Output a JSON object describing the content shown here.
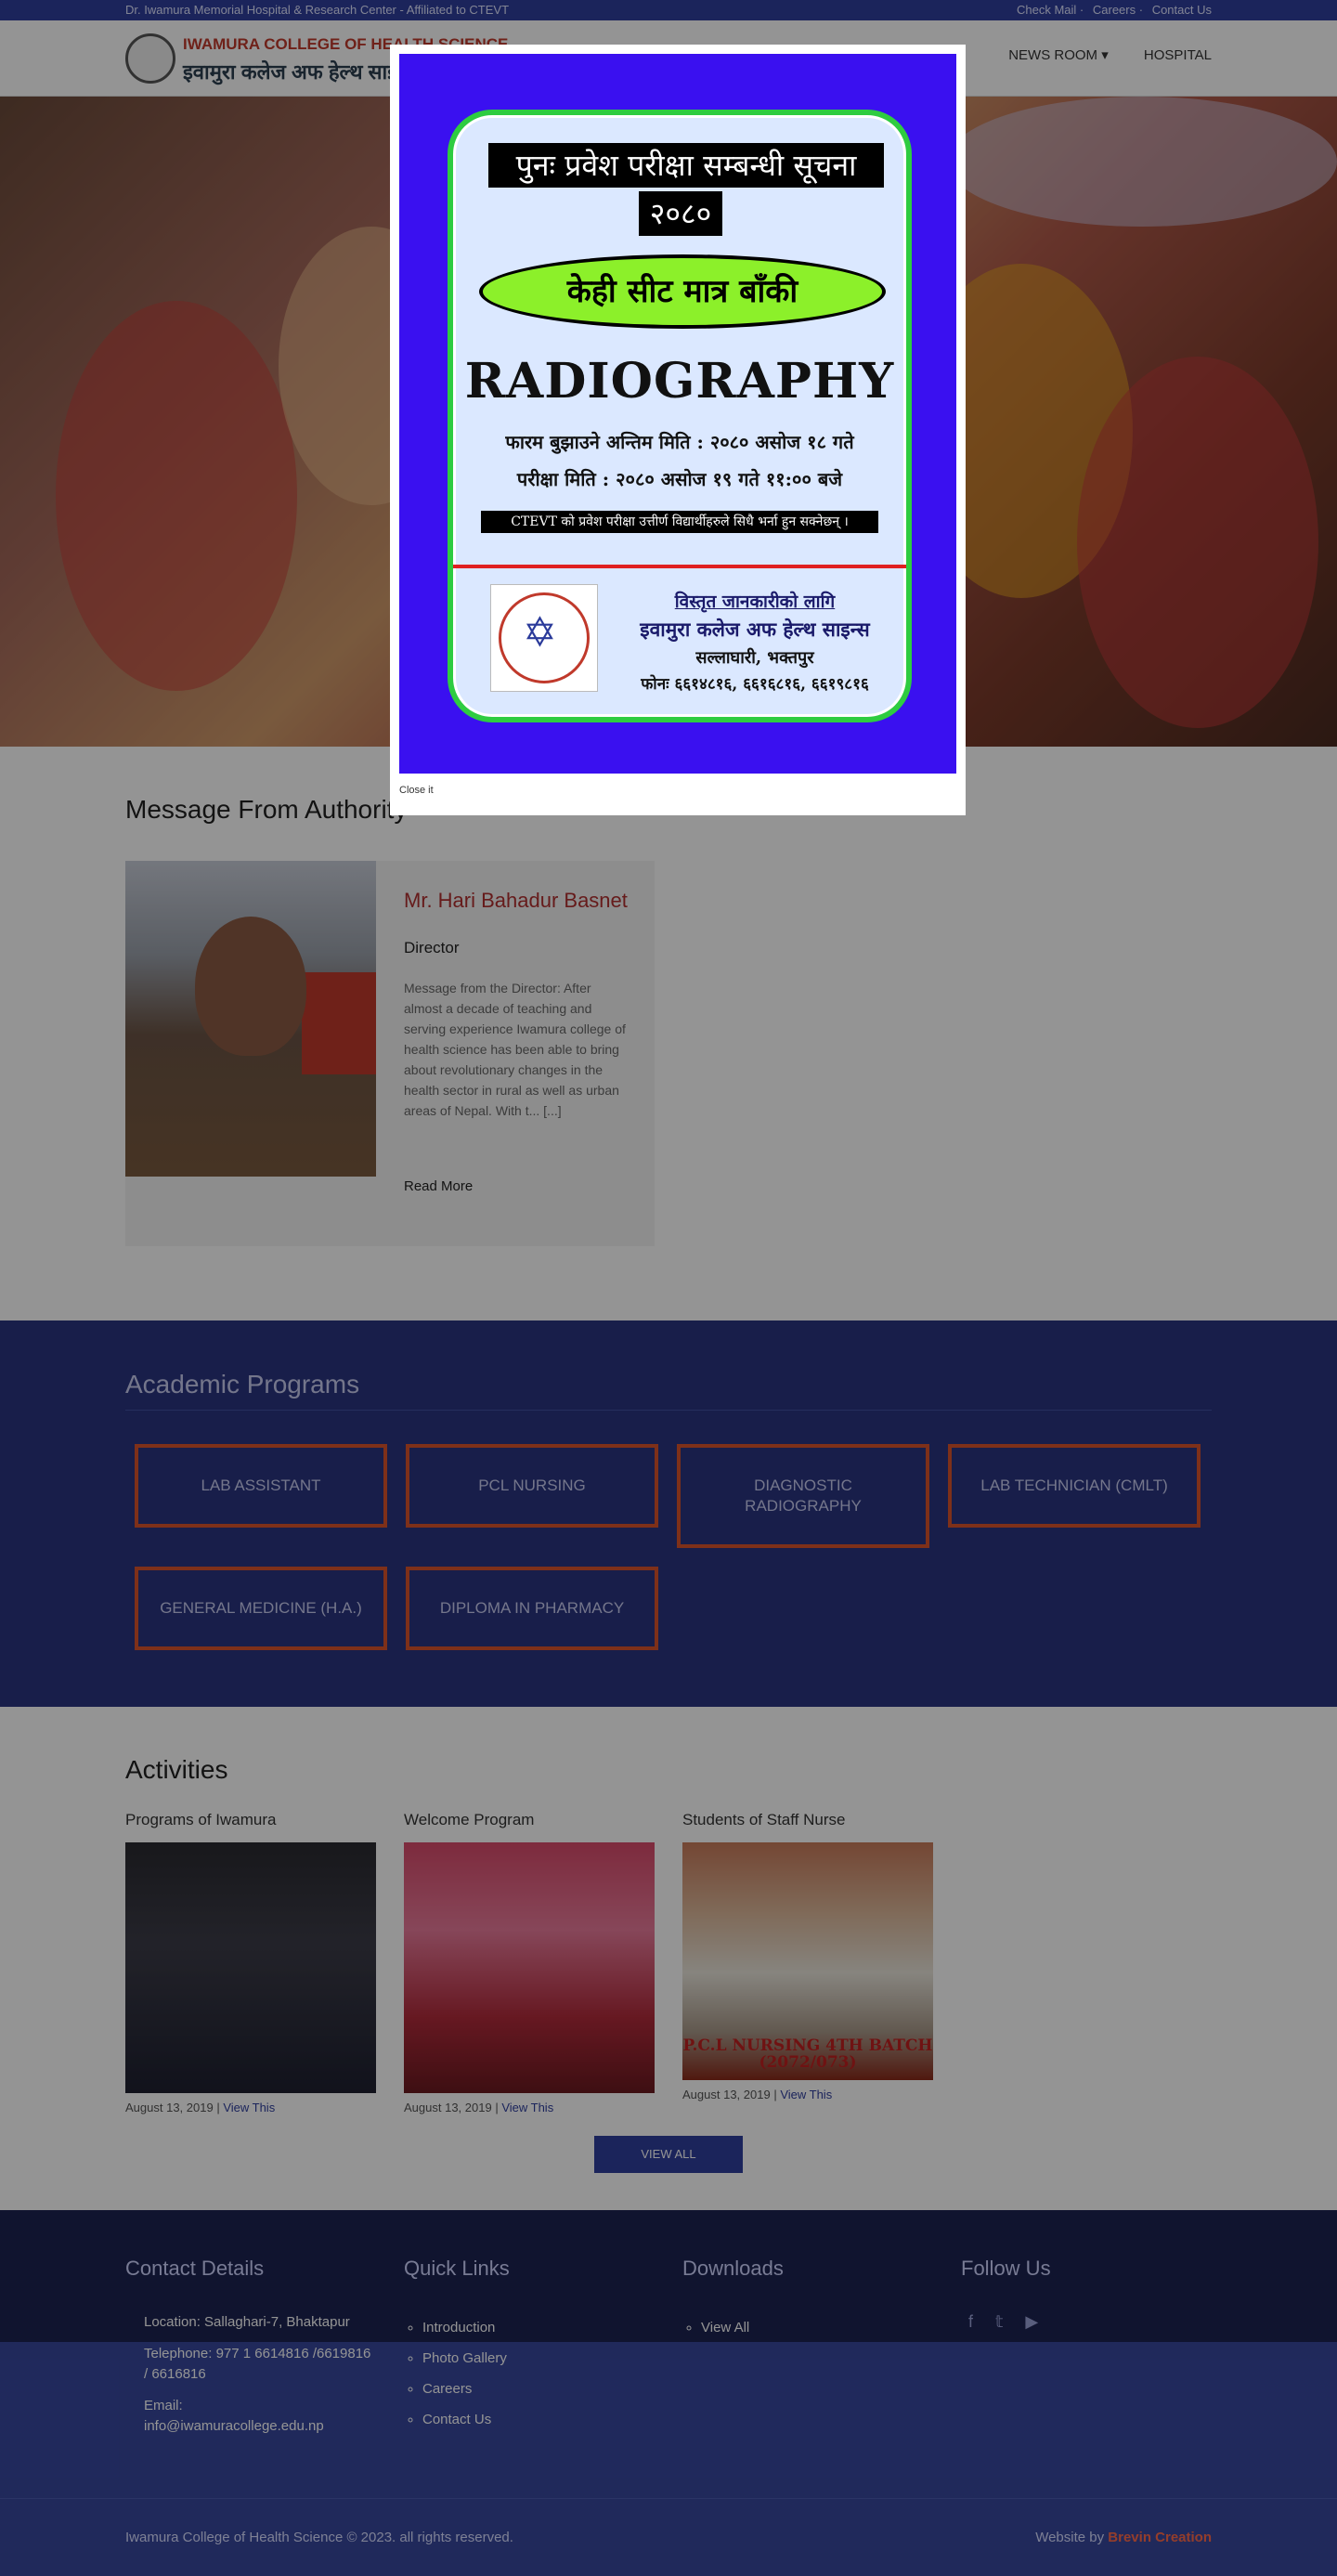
{
  "topbar": {
    "left": "Dr. Iwamura Memorial Hospital & Research Center - Affiliated to CTEVT",
    "links": [
      "Check Mail",
      "Careers",
      "Contact Us"
    ]
  },
  "header": {
    "logo_line1": "IWAMURA COLLEGE OF HEALTH SCIENCE",
    "logo_line2": "इवामुरा कलेज अफ हेल्थ साइन्स",
    "nav": [
      "NEWS ROOM ▾",
      "HOSPITAL"
    ]
  },
  "authority": {
    "title": "Message From Authority",
    "name": "Mr. Hari Bahadur Basnet",
    "role": "Director",
    "message": "Message from the Director: After almost a decade of teaching and serving experience Iwamura college of health science has been able to bring about revolutionary changes in the health sector in rural as well as urban areas of Nepal. With t... [...]",
    "read_more": "Read More"
  },
  "programs": {
    "title": "Academic Programs",
    "items": [
      "LAB ASSISTANT",
      "PCL NURSING",
      "DIAGNOSTIC RADIOGRAPHY",
      "LAB TECHNICIAN (CMLT)",
      "GENERAL MEDICINE (H.A.)",
      "DIPLOMA IN PHARMACY"
    ]
  },
  "activities": {
    "title": "Activities",
    "items": [
      {
        "caption": "Programs of Iwamura",
        "date": "August 13, 2019",
        "link": "View This"
      },
      {
        "caption": "Welcome Program",
        "date": "August 13, 2019",
        "link": "View This"
      },
      {
        "caption": "Students of Staff Nurse",
        "date": "August 13, 2019",
        "link": "View This"
      }
    ],
    "photo3_banner": "P.C.L NURSING 4TH BATCH (2072/073)",
    "view_all": "VIEW ALL"
  },
  "footer": {
    "contact_title": "Contact Details",
    "location": "Location: Sallaghari-7, Bhaktapur",
    "telephone": "Telephone: 977 1 6614816 /6619816 / 6616816",
    "email_label": "Email:",
    "email": "info@iwamuracollege.edu.np",
    "quick_title": "Quick Links",
    "quick_links": [
      "Introduction",
      "Photo Gallery",
      "Careers",
      "Contact Us"
    ],
    "downloads_title": "Downloads",
    "downloads": [
      "View All"
    ],
    "follow_title": "Follow Us",
    "social_icons": [
      "facebook-icon",
      "twitter-icon",
      "youtube-icon"
    ],
    "copyright": "Iwamura College of Health Science © 2023. all rights reserved.",
    "credit_prefix": "Website by",
    "credit_name": "Brevin Creation"
  },
  "modal": {
    "headline": "पुनः प्रवेश परीक्षा सम्बन्धी सूचना",
    "year": "२०८०",
    "seats": "केही सीट मात्र बाँकी",
    "program": "RADIOGRAPHY",
    "deadline": "फारम बुझाउने अन्तिम मिति : २०८० असोज १८ गते",
    "exam_date": "परीक्षा मिति : २०८० असोज १९ गते ११:०० बजे",
    "ctevt_notice": "CTEVT को प्रवेश परीक्षा उत्तीर्ण विद्यार्थीहरुले सिधै भर्ना हुन सक्नेछन् ।",
    "info_heading": "विस्तृत जानकारीको लागि",
    "college": "इवामुरा कलेज अफ हेल्थ साइन्स",
    "address": "सल्लाघारी, भक्तपुर",
    "phone": "फोनः ६६१४८१६, ६६१६८१६, ६६१९८१६",
    "close_label": "Close it"
  }
}
